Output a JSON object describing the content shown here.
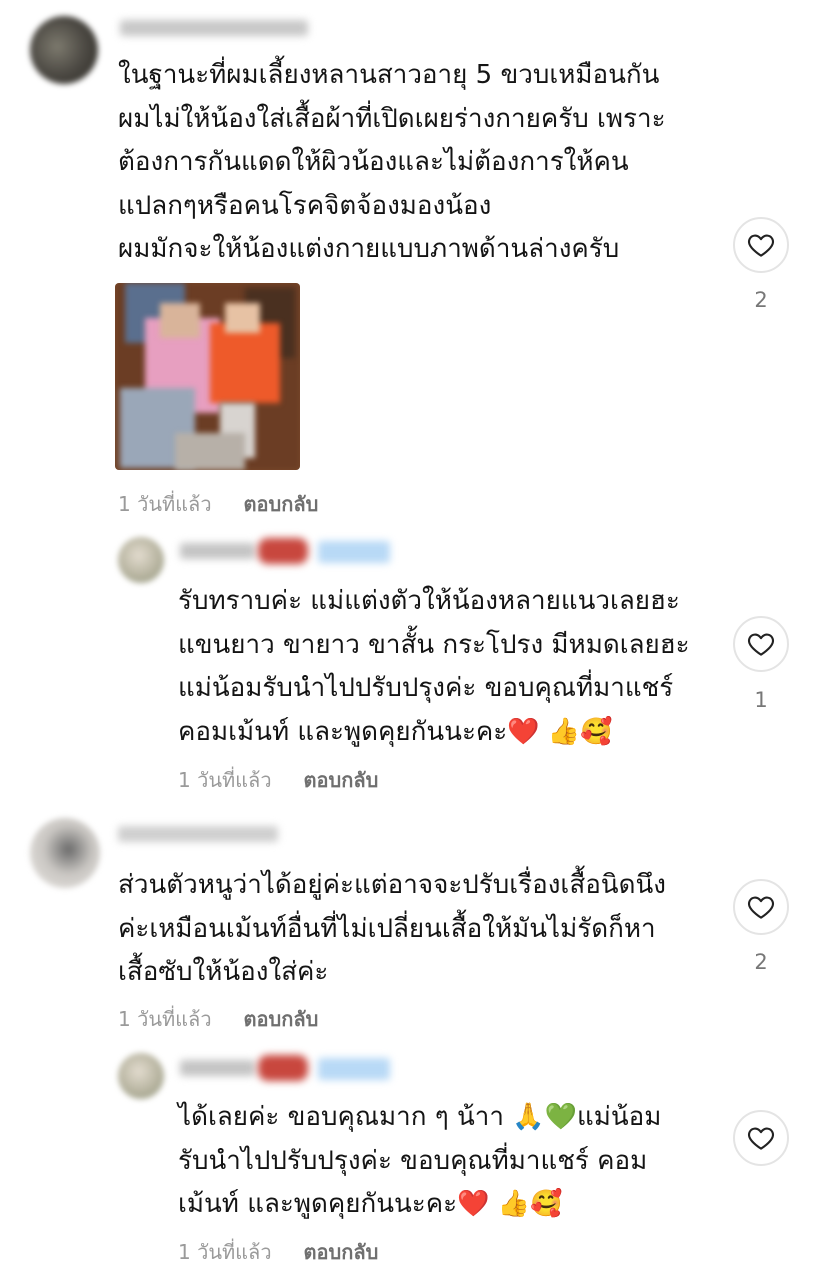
{
  "comments": [
    {
      "lines": [
        "ในฐานะที่ผมเลี้ยงหลานสาวอายุ 5 ขวบเหมือนกัน",
        "ผมไม่ให้น้องใส่เสื้อผ้าที่เปิดเผยร่างกายครับ เพราะ",
        "ต้องการกันแดดให้ผิวน้องและไม่ต้องการให้คน",
        "แปลกๆหรือคนโรคจิตจ้องมองน้อง",
        "ผมมักจะให้น้องแต่งกายแบบภาพด้านล่างครับ"
      ],
      "time": "1 วันที่แล้ว",
      "reply": "ตอบกลับ",
      "likes": "2",
      "has_photo": true
    },
    {
      "lines": [
        "รับทราบค่ะ แม่แต่งตัวให้น้องหลายแนวเลยฮะ",
        "แขนยาว ขายาว ขาสั้น กระโปรง มีหมดเลยฮะ",
        "แม่น้อมรับนำไปปรับปรุงค่ะ ขอบคุณที่มาแชร์",
        "คอมเม้นท์ และพูดคุยกันนะคะ❤️ 👍🥰"
      ],
      "time": "1 วันที่แล้ว",
      "reply": "ตอบกลับ",
      "likes": "1",
      "is_reply": true
    },
    {
      "lines": [
        "ส่วนตัวหนูว่าได้อยู่ค่ะแต่อาจจะปรับเรื่องเสื้อนิดนึง",
        "ค่ะเหมือนเม้นท์อื่นที่ไม่เปลี่ยนเสื้อให้มันไม่รัดก็หา",
        "เสื้อซับให้น้องใส่ค่ะ"
      ],
      "time": "1 วันที่แล้ว",
      "reply": "ตอบกลับ",
      "likes": "2"
    },
    {
      "lines": [
        "ได้เลยค่ะ ขอบคุณมาก ๆ น้าา 🙏💚แม่น้อม",
        "รับนำไปปรับปรุงค่ะ ขอบคุณที่มาแชร์ คอม",
        "เม้นท์ และพูดคุยกันนะคะ❤️ 👍🥰"
      ],
      "time": "1 วันที่แล้ว",
      "reply": "ตอบกลับ",
      "is_reply": true
    }
  ],
  "icons": {
    "like": "heart-outline-icon"
  },
  "colors": {
    "text": "#141414",
    "meta": "#8e8e8e",
    "creator_badge": "#3897f0"
  }
}
